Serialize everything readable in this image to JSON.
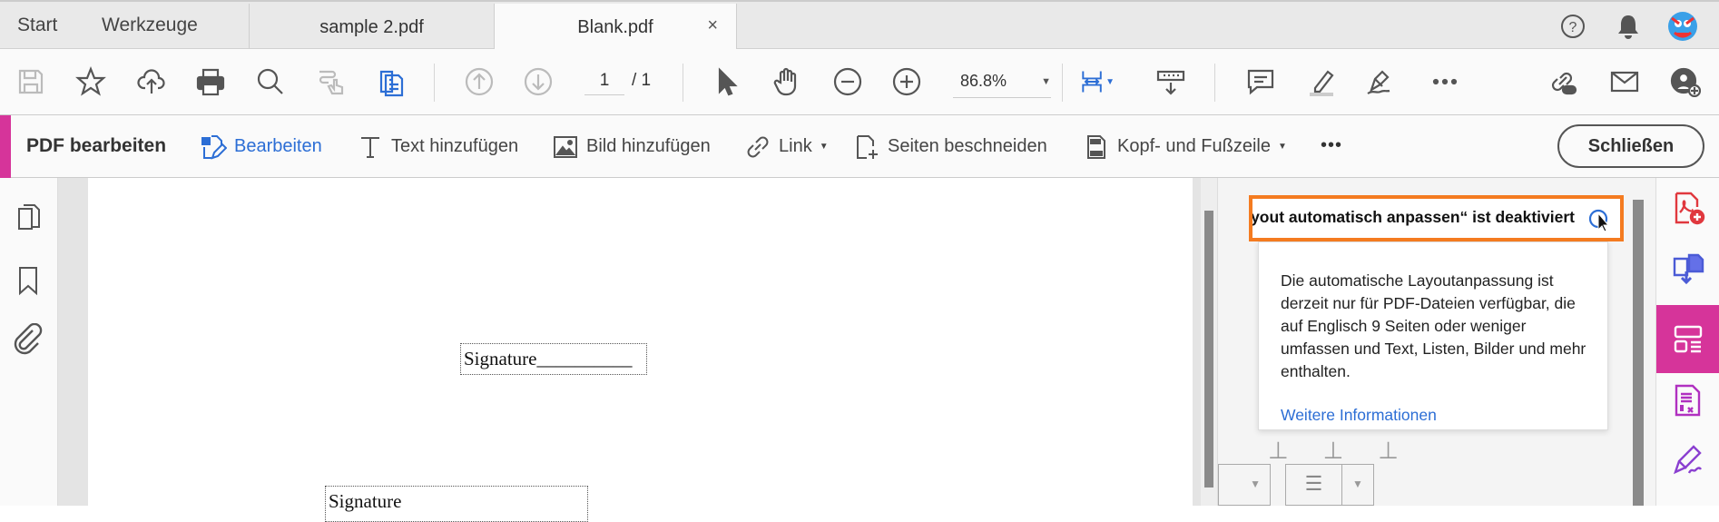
{
  "tabs": {
    "start": "Start",
    "tools": "Werkzeuge",
    "doc1": "sample 2.pdf",
    "doc2": "Blank.pdf",
    "close": "×"
  },
  "toolbar": {
    "page_current": "1",
    "page_total": "/ 1",
    "zoom": "86.8%"
  },
  "editbar": {
    "title": "PDF bearbeiten",
    "edit": "Bearbeiten",
    "add_text": "Text hinzufügen",
    "add_image": "Bild hinzufügen",
    "link": "Link",
    "crop": "Seiten beschneiden",
    "header_footer": "Kopf- und Fußzeile",
    "more": "•••",
    "close": "Schließen"
  },
  "document": {
    "sig1": "Signature__________",
    "sig2": "Signature"
  },
  "popup": {
    "title": "„Layout automatisch anpassen“ ist deaktiviert",
    "body": "Die automatische Layoutanpassung ist derzeit nur für PDF-Dateien verfügbar, die auf Englisch 9 Seiten oder weniger umfassen und Text, Listen, Bilder und mehr enthalten.",
    "link": "Weitere Informationen"
  },
  "colors": {
    "accent": "#d6349a",
    "link": "#2c6ed5",
    "highlight": "#f47b20"
  }
}
